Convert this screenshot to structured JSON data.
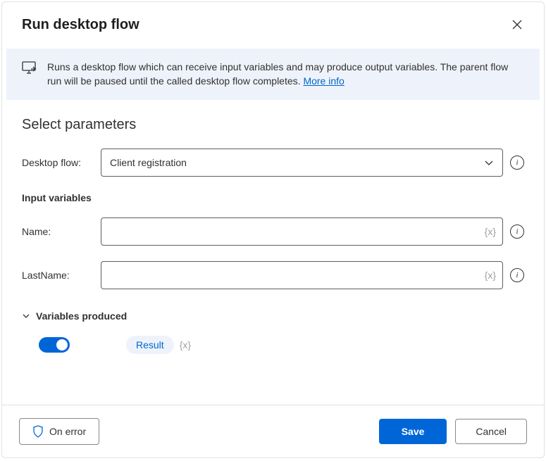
{
  "header": {
    "title": "Run desktop flow"
  },
  "banner": {
    "text": "Runs a desktop flow which can receive input variables and may produce output variables. The parent flow run will be paused until the called desktop flow completes. ",
    "link_label": "More info"
  },
  "parameters": {
    "section_title": "Select parameters",
    "desktop_flow_label": "Desktop flow:",
    "desktop_flow_value": "Client registration",
    "input_vars_label": "Input variables",
    "fields": [
      {
        "label": "Name:",
        "value": ""
      },
      {
        "label": "LastName:",
        "value": ""
      }
    ],
    "vars_produced_label": "Variables produced",
    "result_label": "Result",
    "var_placeholder": "{x}"
  },
  "footer": {
    "on_error_label": "On error",
    "save_label": "Save",
    "cancel_label": "Cancel"
  }
}
